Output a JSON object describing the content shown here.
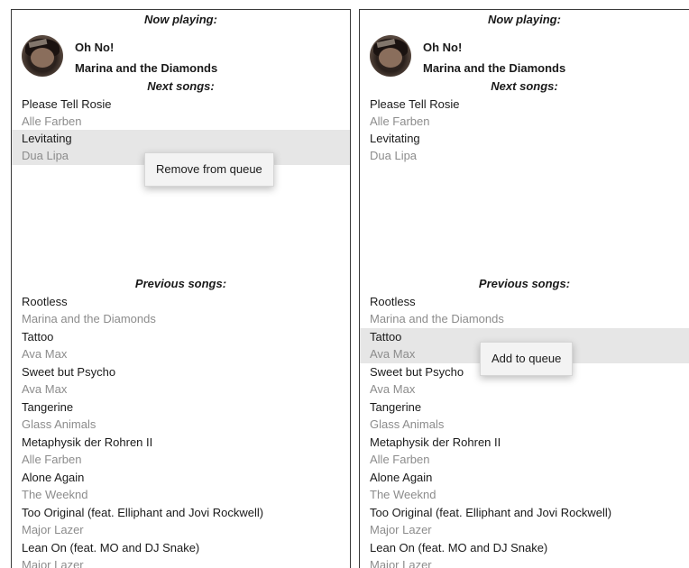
{
  "left": {
    "now_playing_heading": "Now playing:",
    "now_playing": {
      "title": "Oh No!",
      "artist": "Marina and the Diamonds"
    },
    "next_heading": "Next songs:",
    "next_songs": [
      {
        "title": "Please Tell Rosie",
        "artist": "Alle Farben"
      },
      {
        "title": "Levitating",
        "artist": "Dua Lipa"
      }
    ],
    "previous_heading": "Previous songs:",
    "previous_songs": [
      {
        "title": "Rootless",
        "artist": "Marina and the Diamonds"
      },
      {
        "title": "Tattoo",
        "artist": "Ava Max"
      },
      {
        "title": "Sweet but Psycho",
        "artist": "Ava Max"
      },
      {
        "title": "Tangerine",
        "artist": "Glass Animals"
      },
      {
        "title": "Metaphysik der Rohren II",
        "artist": "Alle Farben"
      },
      {
        "title": "Alone Again",
        "artist": "The Weeknd"
      },
      {
        "title": "Too Original (feat. Elliphant and Jovi Rockwell)",
        "artist": "Major Lazer"
      },
      {
        "title": "Lean On (feat. MO and DJ Snake)",
        "artist": "Major Lazer"
      }
    ],
    "context_menu": {
      "label": "Remove from queue"
    }
  },
  "right": {
    "now_playing_heading": "Now playing:",
    "now_playing": {
      "title": "Oh No!",
      "artist": "Marina and the Diamonds"
    },
    "next_heading": "Next songs:",
    "next_songs": [
      {
        "title": "Please Tell Rosie",
        "artist": "Alle Farben"
      },
      {
        "title": "Levitating",
        "artist": "Dua Lipa"
      }
    ],
    "previous_heading": "Previous songs:",
    "previous_songs": [
      {
        "title": "Rootless",
        "artist": "Marina and the Diamonds"
      },
      {
        "title": "Tattoo",
        "artist": "Ava Max"
      },
      {
        "title": "Sweet but Psycho",
        "artist": "Ava Max"
      },
      {
        "title": "Tangerine",
        "artist": "Glass Animals"
      },
      {
        "title": "Metaphysik der Rohren II",
        "artist": "Alle Farben"
      },
      {
        "title": "Alone Again",
        "artist": "The Weeknd"
      },
      {
        "title": "Too Original (feat. Elliphant and Jovi Rockwell)",
        "artist": "Major Lazer"
      },
      {
        "title": "Lean On (feat. MO and DJ Snake)",
        "artist": "Major Lazer"
      }
    ],
    "context_menu": {
      "label": "Add to queue"
    }
  },
  "colors": {
    "highlight": "#e6e6e6",
    "artist_text": "#8c8c8c",
    "border": "#3a3a3a"
  }
}
